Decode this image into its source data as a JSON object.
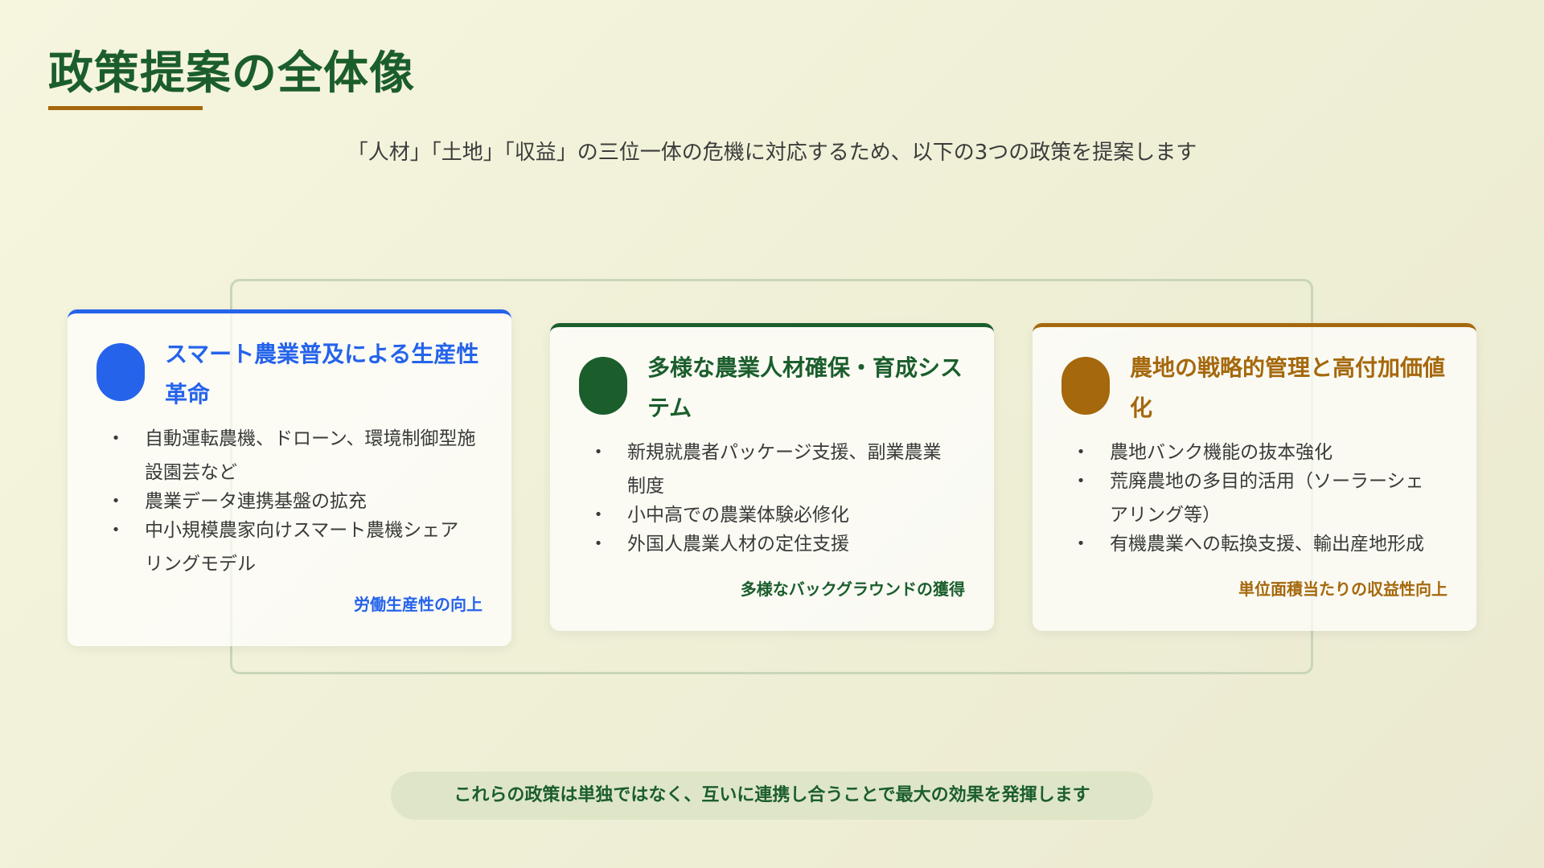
{
  "title": "政策提案の全体像",
  "subtitle": "「人材」「土地」「収益」の三位一体の危機に対応するため、以下の3つの政策を提案します",
  "colors": {
    "title_green": "#1b5e2c",
    "accent_gold": "#a5680c",
    "accent_blue": "#2563eb"
  },
  "cards": [
    {
      "title": "スマート農業普及による生産性革命",
      "accent": "#2563eb",
      "items": [
        "自動運転農機、ドローン、環境制御型施設園芸など",
        "農業データ連携基盤の拡充",
        "中小規模農家向けスマート農機シェアリングモデル"
      ],
      "footer": "労働生産性の向上"
    },
    {
      "title": "多様な農業人材確保・育成システム",
      "accent": "#1b5e2c",
      "items": [
        "新規就農者パッケージ支援、副業農業制度",
        "小中高での農業体験必修化",
        "外国人農業人材の定住支援"
      ],
      "footer": "多様なバックグラウンドの獲得"
    },
    {
      "title": "農地の戦略的管理と高付加価値化",
      "accent": "#a5680c",
      "items": [
        "農地バンク機能の抜本強化",
        "荒廃農地の多目的活用（ソーラーシェアリング等）",
        "有機農業への転換支援、輸出産地形成"
      ],
      "footer": "単位面積当たりの収益性向上"
    }
  ],
  "bullet_symbol": "•",
  "banner": "これらの政策は単独ではなく、互いに連携し合うことで最大の効果を発揮します"
}
